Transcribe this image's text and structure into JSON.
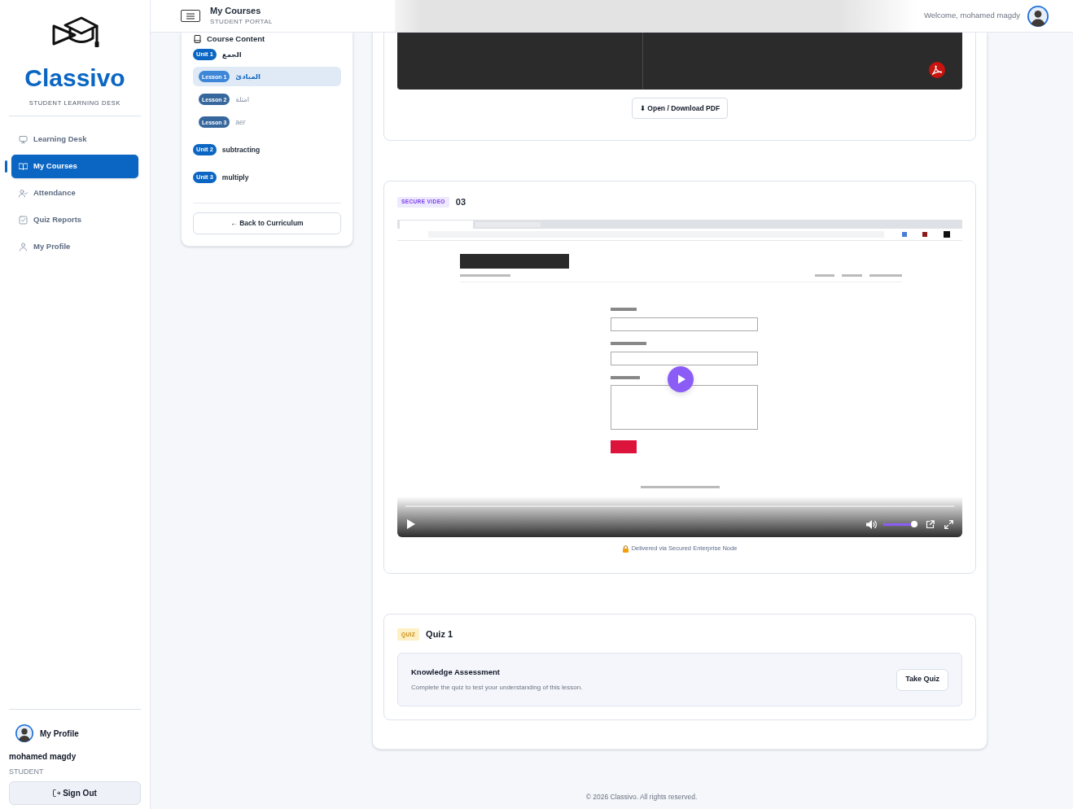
{
  "sidebar": {
    "brand": "Classivo",
    "tagline": "STUDENT LEARNING DESK",
    "nav_items": [
      {
        "label": "Learning Desk",
        "selected": false
      },
      {
        "label": "My Courses",
        "selected": true
      },
      {
        "label": "Attendance",
        "selected": false
      },
      {
        "label": "Quiz Reports",
        "selected": false
      },
      {
        "label": "My Profile",
        "selected": false
      }
    ],
    "profile": {
      "link": "My Profile",
      "name": "mohamed magdy",
      "role": "STUDENT"
    },
    "sign_out": "Sign Out"
  },
  "header": {
    "title": "My Courses",
    "subtitle": "STUDENT PORTAL",
    "welcome": "Welcome, mohamed magdy"
  },
  "course_content": {
    "title": "Course Content",
    "units": [
      {
        "badge": "Unit 1",
        "title": "الجمع",
        "children": [
          {
            "badge": "Lesson 1",
            "title": "المبادئ",
            "selected": true
          },
          {
            "badge": "Lesson 2",
            "title": "امثلة",
            "selected": false
          },
          {
            "badge": "Lesson 3",
            "title": "aer",
            "selected": false
          }
        ]
      },
      {
        "badge": "Unit 2",
        "title": "subtracting"
      },
      {
        "badge": "Unit 3",
        "title": "multiply"
      }
    ],
    "back_button": "← Back to Curriculum"
  },
  "pdf_section": {
    "button": "⬇ Open / Download PDF"
  },
  "video_section": {
    "badge": "SECURE VIDEO",
    "title": "03",
    "volume": {
      "level": 0.9
    },
    "note": "Delivered via Secured Enterprise Node"
  },
  "quiz_section": {
    "badge": "QUIZ",
    "title": "Quiz 1",
    "heading": "Knowledge Assessment",
    "description": "Complete the quiz to test your understanding of this lesson.",
    "button": "Take Quiz"
  },
  "footer": "© 2026 Classivo. All rights reserved."
}
